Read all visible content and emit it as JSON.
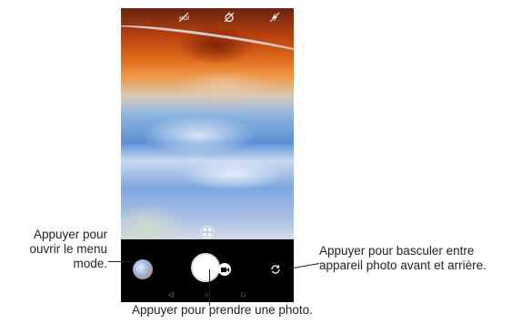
{
  "top_bar": {
    "icons": [
      "hdr-off-icon",
      "timer-off-icon",
      "flash-off-icon"
    ]
  },
  "controls": {
    "mode_menu_button": "gallery-thumbnail",
    "shutter_button": "shutter",
    "video_button": "video-camera-icon",
    "switch_camera_button": "switch-camera-icon"
  },
  "nav_bar": {
    "back": "◁",
    "home": "○",
    "recents": "□"
  },
  "annotations": {
    "left_line1": "Appuyer pour",
    "left_line2": "ouvrir le menu",
    "left_line3": "mode.",
    "right_line1": "Appuyer pour basculer entre",
    "right_line2": "appareil photo avant et arrière.",
    "bottom": "Appuyer pour prendre une photo."
  },
  "colors": {
    "controls_background": "#000000",
    "annotation_text": "#222222"
  }
}
